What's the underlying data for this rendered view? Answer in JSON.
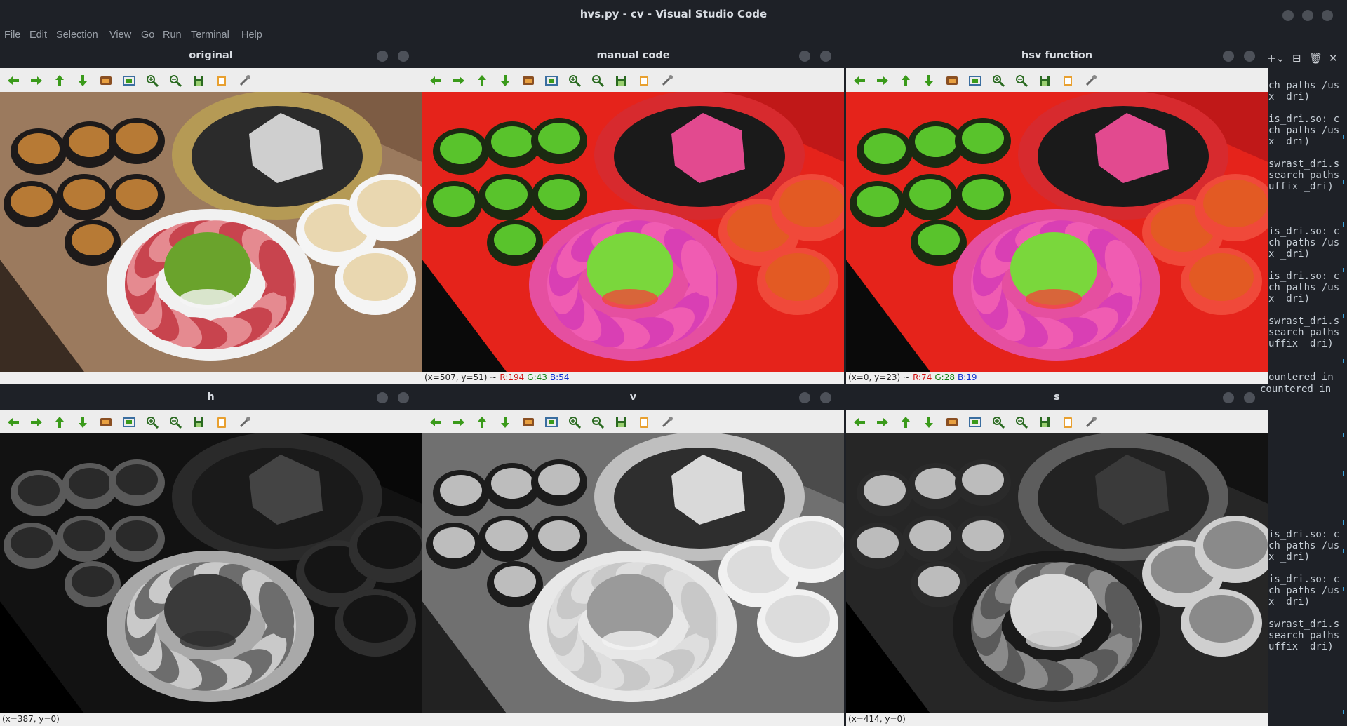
{
  "app": {
    "title": "hvs.py - cv - Visual Studio Code"
  },
  "menu": [
    "File",
    "Edit",
    "Selection",
    "View",
    "Go",
    "Run",
    "Terminal",
    "Help"
  ],
  "windows": [
    {
      "title": "original",
      "status": {
        "coords": "",
        "r": "",
        "g": "",
        "b": ""
      }
    },
    {
      "title": "manual code",
      "status": {
        "coords": "(x=507, y=51) ~ ",
        "r": "R:194",
        "g": "G:43",
        "b": "B:54"
      }
    },
    {
      "title": "hsv function",
      "status": {
        "coords": "(x=0, y=23) ~ ",
        "r": "R:74",
        "g": "G:28",
        "b": "B:19"
      }
    },
    {
      "title": "h",
      "status": {
        "coords": "(x=387, y=0)",
        "r": "",
        "g": "",
        "b": ""
      }
    },
    {
      "title": "v",
      "status": {
        "coords": "",
        "r": "",
        "g": "",
        "b": ""
      }
    },
    {
      "title": "s",
      "status": {
        "coords": "(x=414, y=0)",
        "r": "",
        "g": "",
        "b": ""
      }
    }
  ],
  "toolbar_icons": [
    "pan-left-icon",
    "pan-right-icon",
    "pan-up-icon",
    "pan-down-icon",
    "zoom-image-icon",
    "zoom-fit-icon",
    "zoom-in-icon",
    "zoom-out-icon",
    "save-icon",
    "copy-icon",
    "properties-icon"
  ],
  "terminal": {
    "lines": [
      "ch paths /us",
      "x _dri)",
      "",
      "is_dri.so: c",
      "ch paths /us",
      "x _dri)",
      "",
      "swrast_dri.s",
      "search paths",
      "uffix _dri)",
      "",
      "",
      "",
      "is_dri.so: c",
      "ch paths /us",
      "x _dri)",
      "",
      "is_dri.so: c",
      "ch paths /us",
      "x _dri)",
      "",
      "swrast_dri.s",
      "search paths",
      "uffix _dri)",
      "",
      "",
      "ountered in",
      "",
      "",
      "",
      "",
      "",
      "",
      "",
      "",
      "",
      "",
      "",
      "",
      "",
      "is_dri.so: c",
      "ch paths /us",
      "x _dri)",
      "",
      "is_dri.so: c",
      "ch paths /us",
      "x _dri)",
      "",
      "swrast_dri.s",
      "search paths",
      "uffix _dri)"
    ],
    "overlap_text": "countered in"
  },
  "colors": {
    "red": "#d01010",
    "green": "#108010",
    "blue": "#1030d0",
    "toolbar_green": "#3a9a1a"
  }
}
